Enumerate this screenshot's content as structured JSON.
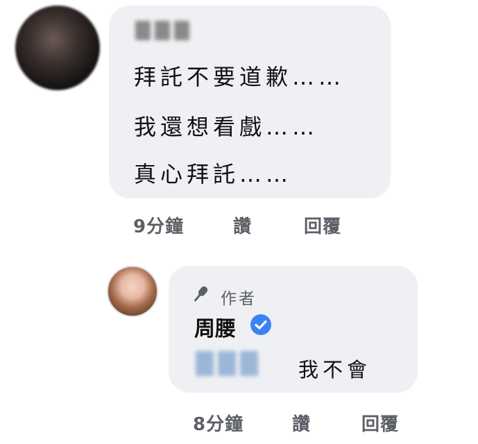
{
  "comment": {
    "lines": [
      "拜託不要道歉……",
      "我還想看戲……",
      "真心拜託……"
    ],
    "time": "9分鐘",
    "like_label": "讚",
    "reply_label": "回覆"
  },
  "reply": {
    "author_badge": "作者",
    "name": "周腰",
    "text": "我不會",
    "time": "8分鐘",
    "like_label": "讚",
    "reply_label": "回覆"
  },
  "colors": {
    "bubble": "#eff0f3",
    "verified": "#3b82f6",
    "meta_text": "#5c5f66"
  },
  "icons": {
    "author_badge": "microphone-icon",
    "verified": "verified-check-icon"
  }
}
